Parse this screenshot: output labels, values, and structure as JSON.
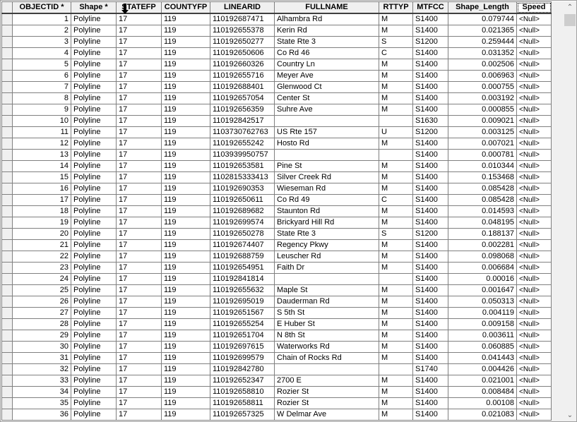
{
  "columns": [
    {
      "key": "sel",
      "label": ""
    },
    {
      "key": "objectid",
      "label": "OBJECTID *"
    },
    {
      "key": "shape",
      "label": "Shape *"
    },
    {
      "key": "statefp",
      "label": "STATEFP"
    },
    {
      "key": "countyfp",
      "label": "COUNTYFP"
    },
    {
      "key": "linearid",
      "label": "LINEARID"
    },
    {
      "key": "fullname",
      "label": "FULLNAME"
    },
    {
      "key": "rttyp",
      "label": "RTTYP"
    },
    {
      "key": "mtfcc",
      "label": "MTFCC"
    },
    {
      "key": "shape_length",
      "label": "Shape_Length"
    },
    {
      "key": "speed",
      "label": "Speed"
    }
  ],
  "rows": [
    [
      "1",
      "Polyline",
      "17",
      "119",
      "110192687471",
      "Alhambra Rd",
      "M",
      "S1400",
      "0.079744",
      "<Null>"
    ],
    [
      "2",
      "Polyline",
      "17",
      "119",
      "110192655378",
      "Kerin Rd",
      "M",
      "S1400",
      "0.021365",
      "<Null>"
    ],
    [
      "3",
      "Polyline",
      "17",
      "119",
      "110192650277",
      "State Rte 3",
      "S",
      "S1200",
      "0.259444",
      "<Null>"
    ],
    [
      "4",
      "Polyline",
      "17",
      "119",
      "110192650606",
      "Co Rd 46",
      "C",
      "S1400",
      "0.031352",
      "<Null>"
    ],
    [
      "5",
      "Polyline",
      "17",
      "119",
      "110192660326",
      "Country Ln",
      "M",
      "S1400",
      "0.002506",
      "<Null>"
    ],
    [
      "6",
      "Polyline",
      "17",
      "119",
      "110192655716",
      "Meyer Ave",
      "M",
      "S1400",
      "0.006963",
      "<Null>"
    ],
    [
      "7",
      "Polyline",
      "17",
      "119",
      "110192688401",
      "Glenwood Ct",
      "M",
      "S1400",
      "0.000755",
      "<Null>"
    ],
    [
      "8",
      "Polyline",
      "17",
      "119",
      "110192657054",
      "Center St",
      "M",
      "S1400",
      "0.003192",
      "<Null>"
    ],
    [
      "9",
      "Polyline",
      "17",
      "119",
      "110192656359",
      "Suhre Ave",
      "M",
      "S1400",
      "0.000855",
      "<Null>"
    ],
    [
      "10",
      "Polyline",
      "17",
      "119",
      "110192842517",
      "",
      "",
      "S1630",
      "0.009021",
      "<Null>"
    ],
    [
      "11",
      "Polyline",
      "17",
      "119",
      "1103730762763",
      "US Rte 157",
      "U",
      "S1200",
      "0.003125",
      "<Null>"
    ],
    [
      "12",
      "Polyline",
      "17",
      "119",
      "110192655242",
      "Hosto Rd",
      "M",
      "S1400",
      "0.007021",
      "<Null>"
    ],
    [
      "13",
      "Polyline",
      "17",
      "119",
      "1103939950757",
      "",
      "",
      "S1400",
      "0.000781",
      "<Null>"
    ],
    [
      "14",
      "Polyline",
      "17",
      "119",
      "110192653581",
      "Pine St",
      "M",
      "S1400",
      "0.010344",
      "<Null>"
    ],
    [
      "15",
      "Polyline",
      "17",
      "119",
      "1102815333413",
      "Silver Creek Rd",
      "M",
      "S1400",
      "0.153468",
      "<Null>"
    ],
    [
      "16",
      "Polyline",
      "17",
      "119",
      "110192690353",
      "Wieseman Rd",
      "M",
      "S1400",
      "0.085428",
      "<Null>"
    ],
    [
      "17",
      "Polyline",
      "17",
      "119",
      "110192650611",
      "Co Rd 49",
      "C",
      "S1400",
      "0.085428",
      "<Null>"
    ],
    [
      "18",
      "Polyline",
      "17",
      "119",
      "110192689682",
      "Staunton Rd",
      "M",
      "S1400",
      "0.014593",
      "<Null>"
    ],
    [
      "19",
      "Polyline",
      "17",
      "119",
      "110192699574",
      "Brickyard Hill Rd",
      "M",
      "S1400",
      "0.048195",
      "<Null>"
    ],
    [
      "20",
      "Polyline",
      "17",
      "119",
      "110192650278",
      "State Rte 3",
      "S",
      "S1200",
      "0.188137",
      "<Null>"
    ],
    [
      "21",
      "Polyline",
      "17",
      "119",
      "110192674407",
      "Regency Pkwy",
      "M",
      "S1400",
      "0.002281",
      "<Null>"
    ],
    [
      "22",
      "Polyline",
      "17",
      "119",
      "110192688759",
      "Leuscher Rd",
      "M",
      "S1400",
      "0.098068",
      "<Null>"
    ],
    [
      "23",
      "Polyline",
      "17",
      "119",
      "110192654951",
      "Faith Dr",
      "M",
      "S1400",
      "0.006684",
      "<Null>"
    ],
    [
      "24",
      "Polyline",
      "17",
      "119",
      "110192841814",
      "",
      "",
      "S1400",
      "0.00016",
      "<Null>"
    ],
    [
      "25",
      "Polyline",
      "17",
      "119",
      "110192655632",
      "Maple St",
      "M",
      "S1400",
      "0.001647",
      "<Null>"
    ],
    [
      "26",
      "Polyline",
      "17",
      "119",
      "110192695019",
      "Dauderman Rd",
      "M",
      "S1400",
      "0.050313",
      "<Null>"
    ],
    [
      "27",
      "Polyline",
      "17",
      "119",
      "110192651567",
      "S 5th St",
      "M",
      "S1400",
      "0.004119",
      "<Null>"
    ],
    [
      "28",
      "Polyline",
      "17",
      "119",
      "110192655254",
      "E Huber St",
      "M",
      "S1400",
      "0.009158",
      "<Null>"
    ],
    [
      "29",
      "Polyline",
      "17",
      "119",
      "110192651704",
      "N 8th St",
      "M",
      "S1400",
      "0.003611",
      "<Null>"
    ],
    [
      "30",
      "Polyline",
      "17",
      "119",
      "110192697615",
      "Waterworks Rd",
      "M",
      "S1400",
      "0.060885",
      "<Null>"
    ],
    [
      "31",
      "Polyline",
      "17",
      "119",
      "110192699579",
      "Chain of Rocks Rd",
      "M",
      "S1400",
      "0.041443",
      "<Null>"
    ],
    [
      "32",
      "Polyline",
      "17",
      "119",
      "110192842780",
      "",
      "",
      "S1740",
      "0.004426",
      "<Null>"
    ],
    [
      "33",
      "Polyline",
      "17",
      "119",
      "110192652347",
      "2700 E",
      "M",
      "S1400",
      "0.021001",
      "<Null>"
    ],
    [
      "34",
      "Polyline",
      "17",
      "119",
      "110192658810",
      "Rozier St",
      "M",
      "S1400",
      "0.008484",
      "<Null>"
    ],
    [
      "35",
      "Polyline",
      "17",
      "119",
      "110192658811",
      "Rozier St",
      "M",
      "S1400",
      "0.00108",
      "<Null>"
    ],
    [
      "36",
      "Polyline",
      "17",
      "119",
      "110192657325",
      "W Delmar Ave",
      "M",
      "S1400",
      "0.021083",
      "<Null>"
    ]
  ],
  "active_column": "Speed",
  "scrollbar": {
    "up_icon": "chevron-up-icon",
    "down_icon": "chevron-down-icon",
    "position_fraction": 0.0
  },
  "colors": {
    "header_bg": "#f0f0f0",
    "grid_line": "#808080"
  }
}
